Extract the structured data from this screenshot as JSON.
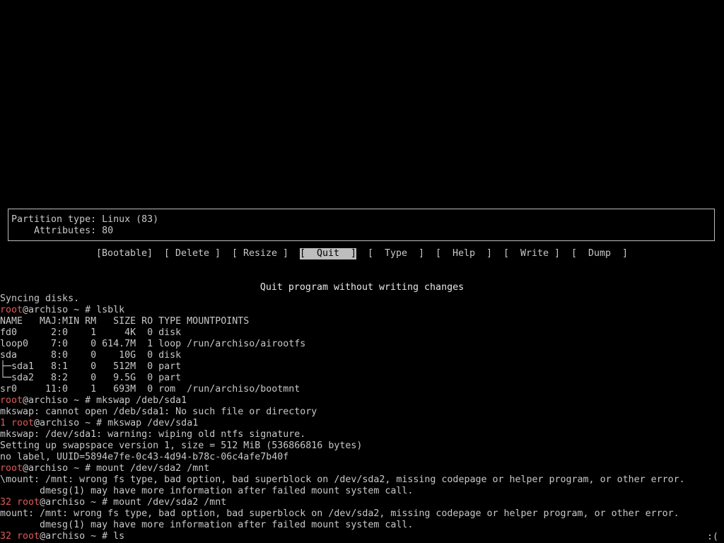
{
  "partition_info": {
    "type_line": "Partition type: Linux (83)",
    "attributes_line": "    Attributes: 80"
  },
  "menu": {
    "items": [
      {
        "label": "[Bootable]",
        "selected": false
      },
      {
        "label": "[ Delete ]",
        "selected": false
      },
      {
        "label": "[ Resize ]",
        "selected": false
      },
      {
        "label": "[  Quit  ]",
        "selected": true
      },
      {
        "label": "[  Type  ]",
        "selected": false
      },
      {
        "label": "[  Help  ]",
        "selected": false
      },
      {
        "label": "[  Write ]",
        "selected": false
      },
      {
        "label": "[  Dump  ]",
        "selected": false
      }
    ]
  },
  "status": {
    "message": "Quit program without writing changes"
  },
  "terminal": {
    "lines": [
      {
        "prefix": "",
        "red": "",
        "rest": "Syncing disks."
      },
      {
        "prefix": "",
        "red": "root",
        "rest": "@archiso ~ # lsblk"
      },
      {
        "prefix": "",
        "red": "",
        "rest": "NAME   MAJ:MIN RM   SIZE RO TYPE MOUNTPOINTS"
      },
      {
        "prefix": "",
        "red": "",
        "rest": "fd0      2:0    1     4K  0 disk"
      },
      {
        "prefix": "",
        "red": "",
        "rest": "loop0    7:0    0 614.7M  1 loop /run/archiso/airootfs"
      },
      {
        "prefix": "",
        "red": "",
        "rest": "sda      8:0    0    10G  0 disk"
      },
      {
        "prefix": "",
        "red": "",
        "rest": "├─sda1   8:1    0   512M  0 part"
      },
      {
        "prefix": "",
        "red": "",
        "rest": "└─sda2   8:2    0   9.5G  0 part"
      },
      {
        "prefix": "",
        "red": "",
        "rest": "sr0     11:0    1   693M  0 rom  /run/archiso/bootmnt"
      },
      {
        "prefix": "",
        "red": "root",
        "rest": "@archiso ~ # mkswap /deb/sda1"
      },
      {
        "prefix": "",
        "red": "",
        "rest": "mkswap: cannot open /deb/sda1: No such file or directory"
      },
      {
        "prefix": "1 ",
        "red": "root",
        "rest": "@archiso ~ # mkswap /dev/sda1"
      },
      {
        "prefix": "",
        "red": "",
        "rest": "mkswap: /dev/sda1: warning: wiping old ntfs signature."
      },
      {
        "prefix": "",
        "red": "",
        "rest": "Setting up swapspace version 1, size = 512 MiB (536866816 bytes)"
      },
      {
        "prefix": "",
        "red": "",
        "rest": "no label, UUID=5894e7fe-0c43-4d94-b78c-06c4afe7b40f"
      },
      {
        "prefix": "",
        "red": "root",
        "rest": "@archiso ~ # mount /dev/sda2 /mnt"
      },
      {
        "prefix": "",
        "red": "",
        "rest": "\\mount: /mnt: wrong fs type, bad option, bad superblock on /dev/sda2, missing codepage or helper program, or other error."
      },
      {
        "prefix": "",
        "red": "",
        "rest": "       dmesg(1) may have more information after failed mount system call."
      },
      {
        "prefix": "32 ",
        "red": "root",
        "rest": "@archiso ~ # mount /dev/sda2 /mnt"
      },
      {
        "prefix": "",
        "red": "",
        "rest": "mount: /mnt: wrong fs type, bad option, bad superblock on /dev/sda2, missing codepage or helper program, or other error."
      },
      {
        "prefix": "",
        "red": "",
        "rest": "       dmesg(1) may have more information after failed mount system call."
      },
      {
        "prefix": "32 ",
        "red": "root",
        "rest": "@archiso ~ # ls"
      }
    ]
  },
  "corner": ":("
}
